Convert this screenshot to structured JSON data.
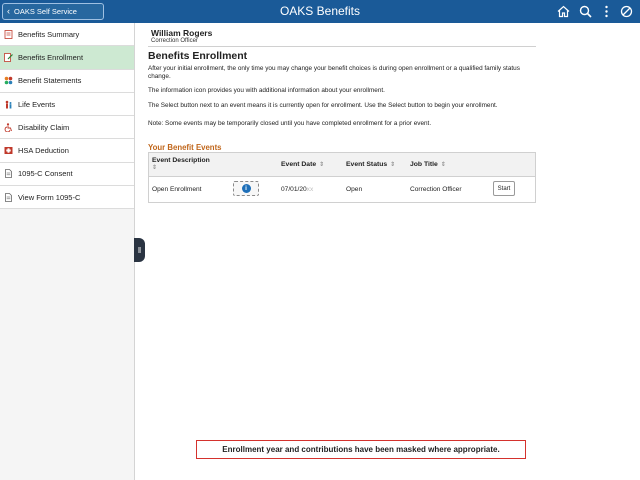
{
  "header": {
    "back_label": "OAKS Self Service",
    "title": "OAKS Benefits",
    "icons": [
      "home-icon",
      "search-icon",
      "more-options-icon",
      "no-symbol-icon"
    ],
    "bar_color": "#1a5a98"
  },
  "sidebar": {
    "items": [
      {
        "label": "Benefits Summary",
        "icon": "benefits-summary-icon"
      },
      {
        "label": "Benefits Enrollment",
        "icon": "benefits-enrollment-icon",
        "active": true
      },
      {
        "label": "Benefit Statements",
        "icon": "benefit-statements-icon"
      },
      {
        "label": "Life Events",
        "icon": "life-events-icon"
      },
      {
        "label": "Disability Claim",
        "icon": "disability-icon"
      },
      {
        "label": "HSA Deduction",
        "icon": "hsa-icon"
      },
      {
        "label": "1095-C Consent",
        "icon": "document-icon"
      },
      {
        "label": "View Form 1095-C",
        "icon": "document-icon"
      }
    ],
    "active_color": "#cde9d2"
  },
  "employee": {
    "name": "William Rogers",
    "job": "Correction Officer"
  },
  "page": {
    "title": "Benefits Enrollment",
    "paragraphs": [
      "After your initial enrollment, the only time you may change your benefit choices is during open enrollment or a qualified family status change.",
      "The information icon provides you with additional information about your enrollment.",
      "The Select button next to an event means it is currently open for enrollment. Use the Select button to begin your enrollment.",
      "Note: Some events may be temporarily closed until you have completed enrollment for a prior event."
    ],
    "section_title": "Your Benefit Events",
    "section_color": "#c0661b"
  },
  "events_table": {
    "columns": [
      "Event Description",
      "Event Date",
      "Event Status",
      "Job Title"
    ],
    "rows": [
      {
        "description": "Open Enrollment",
        "date_visible": "07/01/20",
        "date_masked": "xx",
        "status": "Open",
        "job_title": "Correction Officer",
        "action_label": "Start"
      }
    ]
  },
  "notice": {
    "text": "Enrollment year and contributions have been masked where appropriate.",
    "border_color": "#d4322d"
  }
}
